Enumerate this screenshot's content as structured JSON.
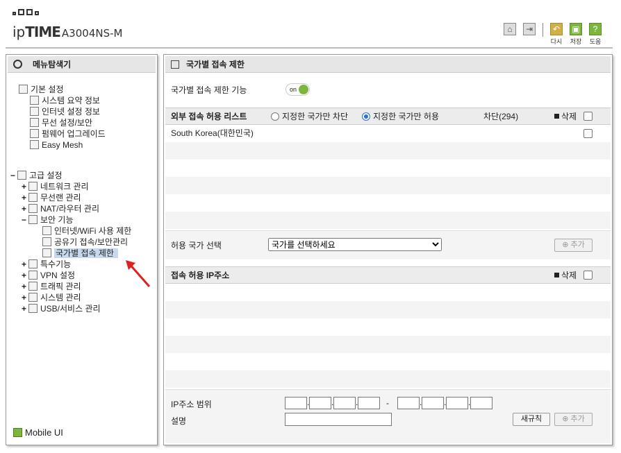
{
  "header": {
    "brand": "ipTIME",
    "model": "A3004NS-M",
    "buttons": [
      {
        "icon": "home-icon",
        "label": ""
      },
      {
        "icon": "logout-icon",
        "label": ""
      },
      {
        "icon": "undo-icon",
        "label": "다시"
      },
      {
        "icon": "save-icon",
        "label": "저장"
      },
      {
        "icon": "help-icon",
        "label": "도움"
      }
    ]
  },
  "sidebar": {
    "title": "메뉴탐색기",
    "basic": {
      "label": "기본 설정",
      "items": [
        "시스템 요약 정보",
        "인터넷 설정 정보",
        "무선 설정/보안",
        "펌웨어 업그레이드",
        "Easy Mesh"
      ]
    },
    "advanced": {
      "label": "고급 설정",
      "items": [
        "네트워크 관리",
        "무선랜 관리",
        "NAT/라우터 관리",
        "보안 기능"
      ],
      "security_children": [
        "인터넷/WiFi 사용 제한",
        "공유기 접속/보안관리",
        "국가별 접속 제한"
      ],
      "items_after": [
        "특수기능",
        "VPN 설정",
        "트래픽 관리",
        "시스템 관리",
        "USB/서비스 관리"
      ]
    },
    "mobile_ui": "Mobile UI"
  },
  "main": {
    "title": "국가별 접속 제한",
    "feature_label": "국가별 접속 제한 기능",
    "toggle": "on",
    "list_header": {
      "title": "외부 접속 허용 리스트",
      "radio_block": "지정한 국가만 차단",
      "radio_allow": "지정한 국가만 허용",
      "block_count": "차단(294)",
      "delete": "삭제"
    },
    "countries": [
      "South Korea(대한민국)"
    ],
    "select_label": "허용 국가 선택",
    "select_placeholder": "국가를 선택하세요",
    "add_button": "추가",
    "ip_header": {
      "title": "접속 허용 IP주소",
      "delete": "삭제"
    },
    "ip_range_label": "IP주소 범위",
    "ip_range_sep": "-",
    "desc_label": "설명",
    "new_rule_button": "새규칙",
    "add_button2": "추가"
  }
}
